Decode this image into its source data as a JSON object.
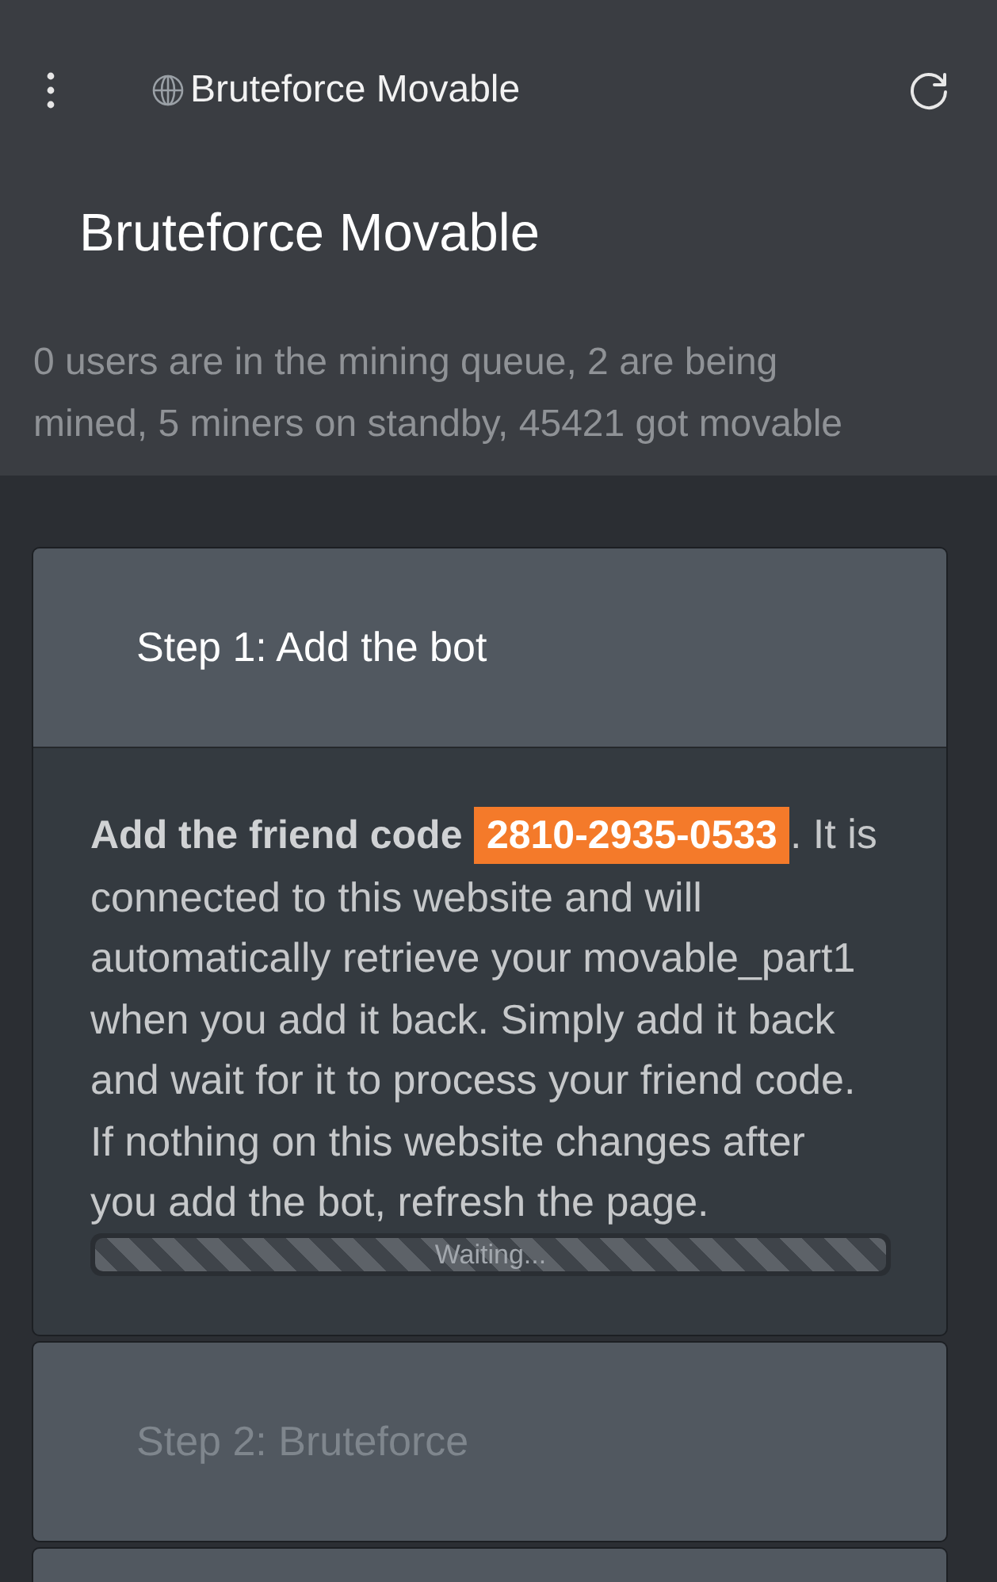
{
  "top_bar": {
    "title": "Bruteforce Movable"
  },
  "header": {
    "title": "Bruteforce Movable",
    "stats": "0 users are in the mining queue, 2 are being mined, 5 miners on standby, 45421 got movable"
  },
  "steps": [
    {
      "title": "Step 1: Add the bot",
      "disabled": false,
      "expanded": true,
      "instructions": {
        "lead": "Add the friend code",
        "friend_code": {
          "text": "2810-2935-0533",
          "highlighted": true
        },
        "text": ". It is connected to this website and will automatically retrieve your movable_part1 when you add it back. Simply add it back and wait for it to process your friend code. If nothing on this website changes after you add the bot, refresh the page."
      },
      "progress": {
        "label": "Waiting...",
        "level": 1
      }
    },
    {
      "title": "Step 2: Bruteforce",
      "disabled": true,
      "expanded": false
    },
    {
      "expanded": false
    }
  ]
}
